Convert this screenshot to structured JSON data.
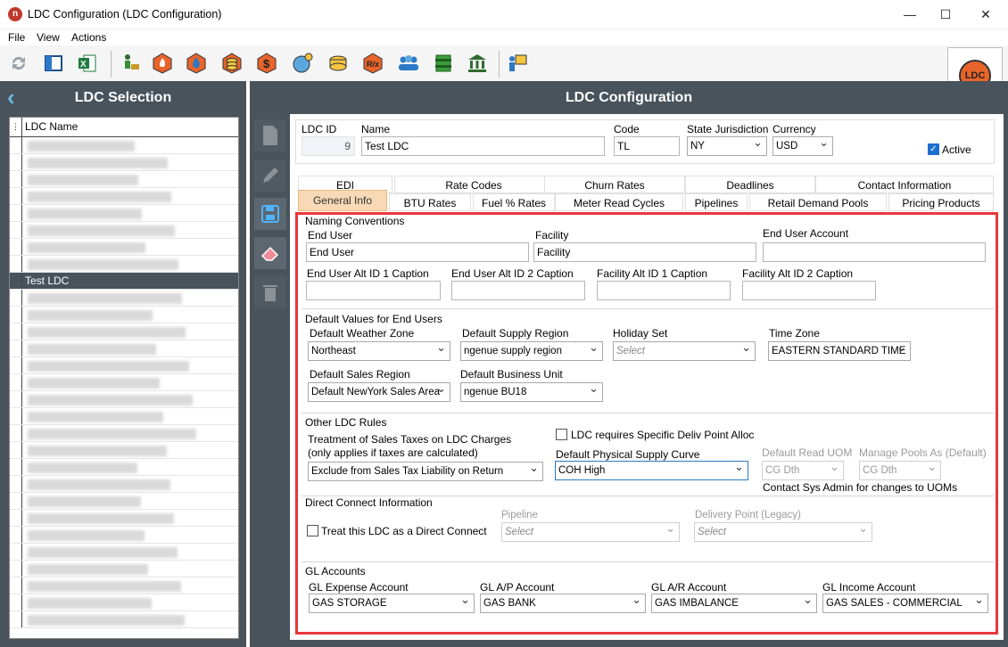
{
  "window": {
    "title": "LDC Configuration (LDC Configuration)",
    "minimize": "—",
    "maximize": "☐",
    "close": "✕"
  },
  "menu": {
    "file": "File",
    "view": "View",
    "actions": "Actions"
  },
  "toolbar": {
    "icons": [
      "refresh-icon",
      "panel-icon",
      "excel-icon",
      "worker-icon",
      "gas-flame-icon",
      "water-drop-icon",
      "coins-icon",
      "dollar-gear-icon",
      "globe-gear-icon",
      "coin-stack-icon",
      "rx-icon",
      "people-icon",
      "barrel-icon",
      "bank-icon",
      "user-board-icon"
    ]
  },
  "logo": {
    "text": "LDC"
  },
  "left": {
    "title": "LDC Selection",
    "back": "‹",
    "column": "LDC Name",
    "selected": "Test LDC"
  },
  "right": {
    "title": "LDC Configuration"
  },
  "header": {
    "ldc_id_label": "LDC ID",
    "ldc_id_value": "9",
    "name_label": "Name",
    "name_value": "Test LDC",
    "code_label": "Code",
    "code_value": "TL",
    "state_label": "State Jurisdiction",
    "state_value": "NY",
    "currency_label": "Currency",
    "currency_value": "USD",
    "active_label": "Active"
  },
  "tabs": {
    "row1": [
      "EDI",
      "Rate Codes",
      "Churn Rates",
      "Deadlines",
      "Contact Information"
    ],
    "row2": [
      "General Info",
      "BTU Rates",
      "Fuel % Rates",
      "Meter Read Cycles",
      "Pipelines",
      "Retail Demand Pools",
      "Pricing Products"
    ]
  },
  "naming": {
    "title": "Naming Conventions",
    "end_user_label": "End User",
    "end_user_value": "End User",
    "facility_label": "Facility",
    "facility_value": "Facility",
    "end_user_account_label": "End User Account",
    "end_user_account_value": "",
    "eu_alt1_label": "End User Alt ID 1 Caption",
    "eu_alt2_label": "End User Alt ID 2 Caption",
    "fac_alt1_label": "Facility Alt ID 1 Caption",
    "fac_alt2_label": "Facility Alt ID 2 Caption"
  },
  "defaults": {
    "title": "Default Values for End Users",
    "weather_label": "Default Weather Zone",
    "weather_value": "Northeast",
    "supply_region_label": "Default Supply Region",
    "supply_region_value": "ngenue supply region",
    "holiday_label": "Holiday Set",
    "holiday_value": "Select",
    "timezone_label": "Time Zone",
    "timezone_value": "EASTERN STANDARD TIME",
    "sales_region_label": "Default Sales Region",
    "sales_region_value": "Default NewYork Sales Area",
    "business_unit_label": "Default Business Unit",
    "business_unit_value": "ngenue BU18"
  },
  "other": {
    "title": "Other LDC Rules",
    "tax_label1": "Treatment of Sales Taxes on LDC Charges",
    "tax_label2": "(only applies if taxes are calculated)",
    "tax_value": "Exclude from Sales Tax Liability on Return",
    "deliv_label": "LDC requires Specific Deliv Point Alloc",
    "curve_label": "Default Physical Supply Curve",
    "curve_value": "COH High",
    "read_uom_label": "Default Read UOM",
    "read_uom_value": "CG Dth",
    "manage_pools_label": "Manage Pools As (Default)",
    "manage_pools_value": "CG Dth",
    "note": "Contact Sys Admin for changes to UOMs"
  },
  "direct": {
    "title": "Direct Connect Information",
    "treat_label": "Treat this LDC as a Direct Connect",
    "pipeline_label": "Pipeline",
    "pipeline_value": "Select",
    "delivery_label": "Delivery Point (Legacy)",
    "delivery_value": "Select"
  },
  "gl": {
    "title": "GL Accounts",
    "expense_label": "GL Expense Account",
    "expense_value": "GAS STORAGE",
    "ap_label": "GL A/P Account",
    "ap_value": "GAS BANK",
    "ar_label": "GL A/R Account",
    "ar_value": "GAS IMBALANCE",
    "income_label": "GL Income Account",
    "income_value": "GAS SALES - COMMERCIAL"
  }
}
